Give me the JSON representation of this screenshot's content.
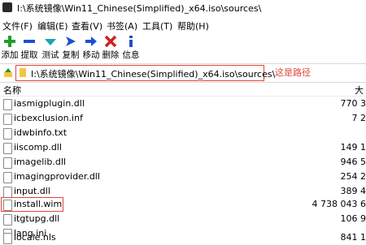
{
  "window": {
    "title": "I:\\系统镜像\\Win11_Chinese(Simplified)_x64.iso\\sources\\"
  },
  "menu": [
    {
      "label": "文件(F)"
    },
    {
      "label": "编辑(E)"
    },
    {
      "label": "查看(V)"
    },
    {
      "label": "书签(A)"
    },
    {
      "label": "工具(T)"
    },
    {
      "label": "帮助(H)"
    }
  ],
  "toolbar": [
    {
      "label": "添加",
      "icon": "plus-icon",
      "color": "#1f9e2a"
    },
    {
      "label": "提取",
      "icon": "minus-icon",
      "color": "#1f4fd1"
    },
    {
      "label": "测试",
      "icon": "check-icon",
      "color": "#16a6b0"
    },
    {
      "label": "复制",
      "icon": "copy-arrow-icon",
      "color": "#1f4fd1"
    },
    {
      "label": "移动",
      "icon": "move-arrow-icon",
      "color": "#1f4fd1"
    },
    {
      "label": "删除",
      "icon": "delete-x-icon",
      "color": "#d11f1f"
    },
    {
      "label": "信息",
      "icon": "info-icon",
      "color": "#1f4fd1"
    }
  ],
  "address": {
    "path": "I:\\系统镜像\\Win11_Chinese(Simplified)_x64.iso\\sources\\",
    "annotation": "这是路径"
  },
  "columns": {
    "name": "名称",
    "size": "大"
  },
  "files": [
    {
      "name": "iasmigplugin.dll",
      "size": "770 3"
    },
    {
      "name": "icbexclusion.inf",
      "size": "7 2"
    },
    {
      "name": "idwbinfo.txt",
      "size": ""
    },
    {
      "name": "iiscomp.dll",
      "size": "149 1"
    },
    {
      "name": "imagelib.dll",
      "size": "946 5"
    },
    {
      "name": "imagingprovider.dll",
      "size": "254 2"
    },
    {
      "name": "input.dll",
      "size": "389 4"
    },
    {
      "name": "install.wim",
      "size": "4 738 043 6",
      "highlighted": true
    },
    {
      "name": "itgtupg.dll",
      "size": "106 9"
    },
    {
      "name": "lang.ini",
      "size": ""
    },
    {
      "name": "locale.nls",
      "size": "841 1"
    }
  ],
  "colors": {
    "annotation_red": "#e0463e"
  }
}
